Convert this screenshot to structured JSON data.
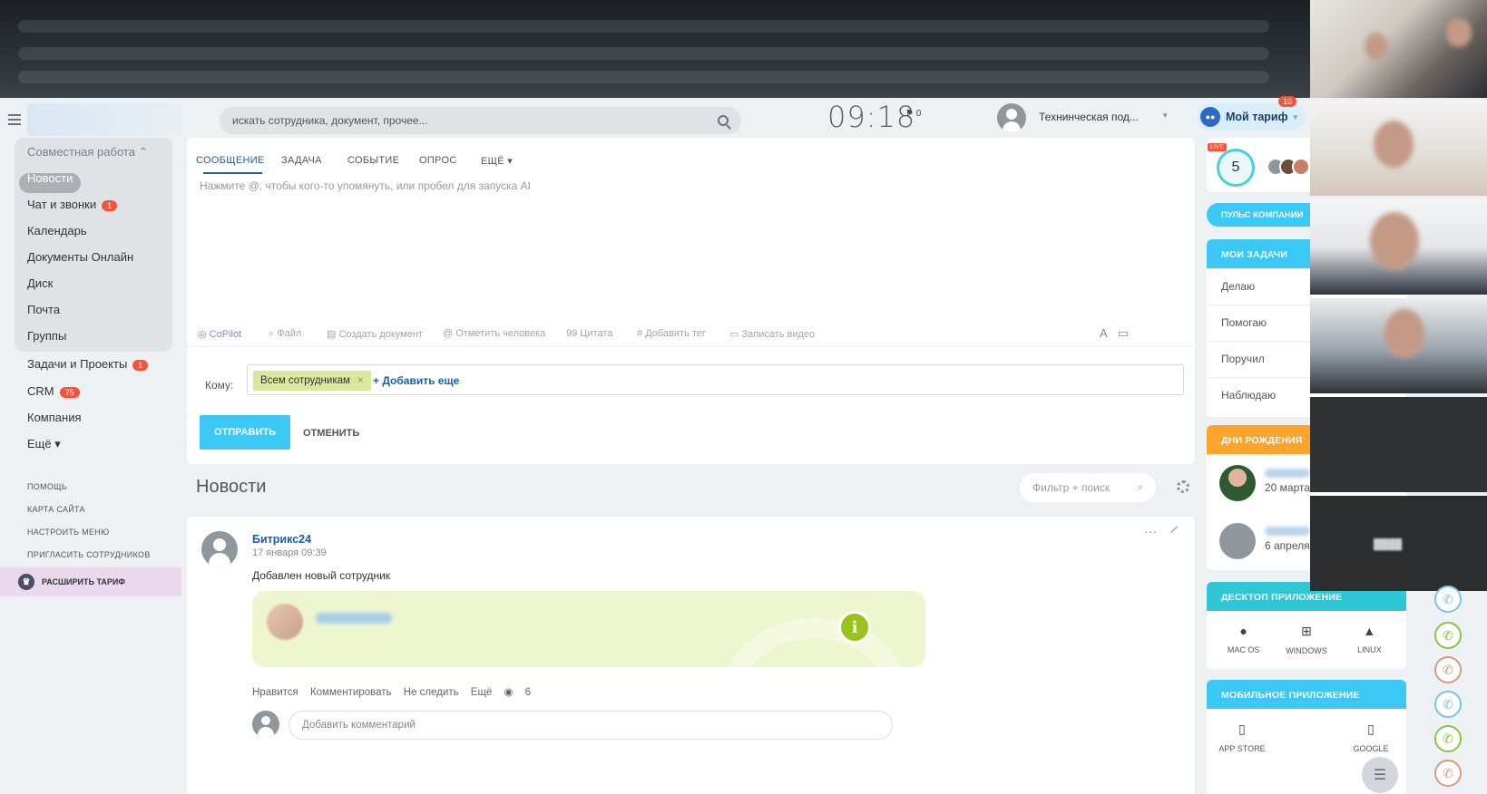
{
  "header": {
    "search_placeholder": "искать сотрудника, документ, прочее...",
    "clock": "09:18",
    "flag_count": "0",
    "user_name": "Технинческая под...",
    "tariff_label": "Мой тариф",
    "tariff_badge": "10"
  },
  "sidebar": {
    "group_title": "Совместная работа ⌃",
    "items": [
      {
        "label": "Новости",
        "badge": ""
      },
      {
        "label": "Чат и звонки",
        "badge": "1"
      },
      {
        "label": "Календарь",
        "badge": ""
      },
      {
        "label": "Документы Онлайн",
        "badge": ""
      },
      {
        "label": "Диск",
        "badge": ""
      },
      {
        "label": "Почта",
        "badge": ""
      },
      {
        "label": "Группы",
        "badge": ""
      },
      {
        "label": "Задачи и Проекты",
        "badge": "1"
      },
      {
        "label": "CRM",
        "badge": "75"
      },
      {
        "label": "Компания",
        "badge": ""
      },
      {
        "label": "Ещё ▾",
        "badge": ""
      }
    ],
    "links": [
      "ПОМОЩЬ",
      "КАРТА САЙТА",
      "НАСТРОИТЬ МЕНЮ",
      "ПРИГЛАСИТЬ СОТРУДНИКОВ"
    ],
    "extend_tariff": "РАСШИРИТЬ ТАРИФ"
  },
  "composer": {
    "tabs": [
      "СООБЩЕНИЕ",
      "ЗАДАЧА",
      "СОБЫТИЕ",
      "ОПРОС",
      "ЕЩЁ ▾"
    ],
    "placeholder": "Нажмите @, чтобы кого-то упомянуть, или пробел для запуска AI",
    "tools": [
      "CoPilot",
      "Файл",
      "Создать документ",
      "Отметить человека",
      "Цитата",
      "Добавить тег",
      "Записать видео"
    ],
    "to_label": "Кому:",
    "recipient": "Всем сотрудникам",
    "add_more": "+ Добавить еще",
    "send": "ОТПРАВИТЬ",
    "cancel": "ОТМЕНИТЬ"
  },
  "feed": {
    "title": "Новости",
    "filter_placeholder": "Фильтр + поиск",
    "post": {
      "author": "Битрикс24",
      "date": "17 января 09:39",
      "text": "Добавлен новый сотрудник",
      "actions": [
        "Нравится",
        "Комментировать",
        "Не следить",
        "Ещё"
      ],
      "views": "6",
      "comment_placeholder": "Добавить комментарий"
    }
  },
  "right": {
    "pulse_live": "LIVE",
    "pulse_value": "5",
    "pulse_button": "ПУЛЬС КОМПАНИИ",
    "tasks_title": "МОИ ЗАДАЧИ",
    "tasks": [
      "Делаю",
      "Помогаю",
      "Поручил",
      "Наблюдаю"
    ],
    "birthdays_title": "ДНИ РОЖДЕНИЯ",
    "birthdays": [
      "20 марта",
      "6 апреля"
    ],
    "desktop_title": "ДЕСКТОП ПРИЛОЖЕНИЕ",
    "desktop_apps": [
      "MAC OS",
      "WINDOWS",
      "LINUX"
    ],
    "mobile_title": "МОБИЛЬНОЕ ПРИЛОЖЕНИЕ",
    "mobile_apps": [
      "APP STORE",
      "GOOGLE"
    ]
  },
  "colors": {
    "accent": "#3bc8f5",
    "pulse_head": "#3bc8f5",
    "birthday_head": "#fea32c",
    "desktop_head": "#2fc6d6",
    "badge": "#f4553a"
  }
}
